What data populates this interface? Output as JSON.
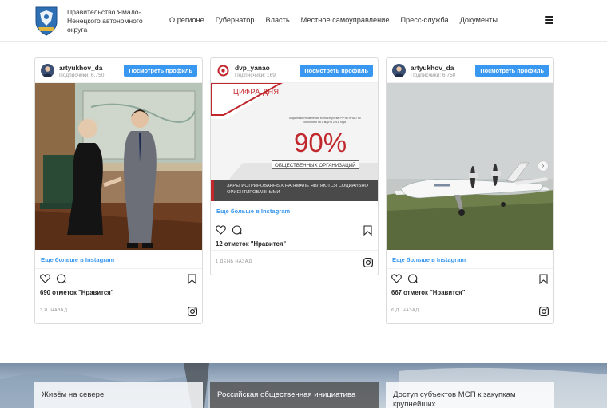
{
  "header": {
    "org_name": "Правительство Ямало-Ненецкого автономного округа",
    "nav": [
      "О регионе",
      "Губернатор",
      "Власть",
      "Местное самоуправление",
      "Пресс-служба",
      "Документы"
    ]
  },
  "cards": [
    {
      "username": "artyukhov_da",
      "subscribers": "Подписчики: 6,750",
      "view_profile": "Посмотреть профиль",
      "more": "Еще больше в Instagram",
      "likes": "690 отметок \"Нравится\"",
      "time": "3 ч. назад"
    },
    {
      "username": "dvp_yanao",
      "subscribers": "Подписчики: 169",
      "view_profile": "Посмотреть профиль",
      "banner_title": "ЦИФРА ДНЯ",
      "banner_small": "По данным Управления Министерства РФ по ЯНАО по состоянию на 1 марта 2018 года",
      "banner_percent": "90%",
      "banner_label": "ОБЩЕСТВЕННЫХ ОРГАНИЗАЦИЙ",
      "banner_footer": "ЗАРЕГИСТРИРОВАННЫХ НА ЯМАЛЕ ЯВЛЯЮТСЯ СОЦИАЛЬНО ОРИЕНТИРОВАННЫМИ",
      "more": "Еще больше в Instagram",
      "likes": "12 отметок \"Нравится\"",
      "time": "1 день назад"
    },
    {
      "username": "artyukhov_da",
      "subscribers": "Подписчики: 6,750",
      "view_profile": "Посмотреть профиль",
      "more": "Еще больше в Instagram",
      "likes": "667 отметок \"Нравится\"",
      "time": "6 д. назад"
    }
  ],
  "bottom_tiles": [
    "Живём на севере",
    "Российская общественная инициатива",
    "Доступ субъектов МСП к закупкам крупнейших"
  ],
  "colors": {
    "accent": "#3897f0",
    "banner_red": "#c0282d"
  }
}
